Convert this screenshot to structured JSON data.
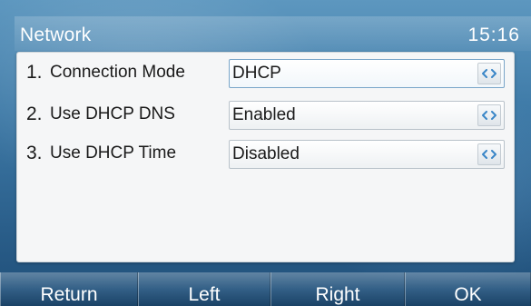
{
  "header": {
    "title": "Network",
    "time": "15:16"
  },
  "settings": {
    "rows": [
      {
        "number": "1.",
        "label": "Connection Mode",
        "value": "DHCP",
        "selected": true
      },
      {
        "number": "2.",
        "label": "Use DHCP DNS",
        "value": "Enabled",
        "selected": false
      },
      {
        "number": "3.",
        "label": "Use DHCP Time",
        "value": "Disabled",
        "selected": false
      }
    ],
    "switch_icon": "left-right-arrows-icon"
  },
  "softkeys": [
    "Return",
    "Left",
    "Right",
    "OK"
  ],
  "colors": {
    "background_top": "#5d97bf",
    "background_bottom": "#1f4e78",
    "panel": "#f5f6f7",
    "arrow": "#3a86c7"
  }
}
